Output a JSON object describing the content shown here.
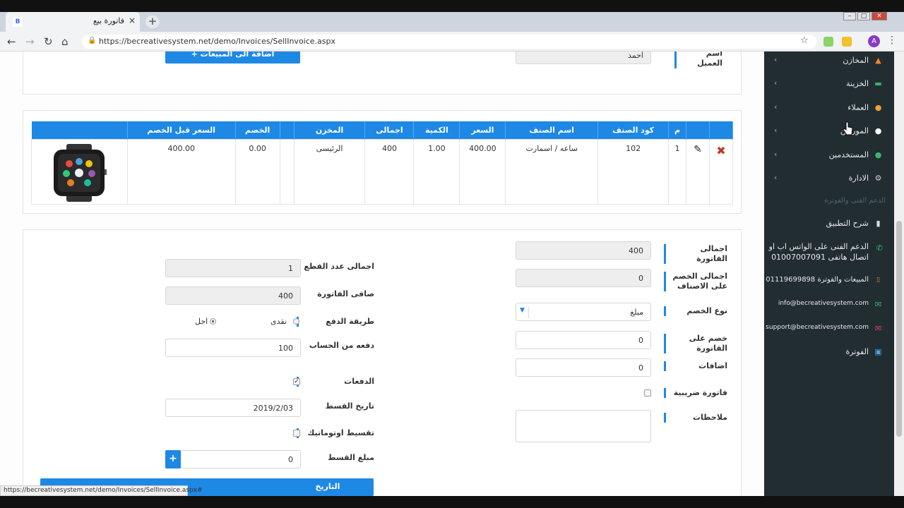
{
  "browser": {
    "tab_title": "فاتورة بيع",
    "favicon_letter": "B",
    "tab_close": "×",
    "new_tab": "+",
    "url": "https://becreativesystem.net/demo/Invoices/SellInvoice.aspx",
    "avatar_letter": "A",
    "status_url": "https://becreativesystem.net/demo/Invoices/SellInvoice.aspx#"
  },
  "customer": {
    "label": "اسم العميل",
    "value": "احمد",
    "add_button": "+ اضافة الى المبيعات"
  },
  "items_table": {
    "headers": [
      "",
      "",
      "م",
      "كود الصنف",
      "اسم الصنف",
      "السعر",
      "الكمية",
      "اجمالى",
      "المخزن",
      "",
      "الخصم",
      "السعر قبل الخصم",
      ""
    ],
    "row": {
      "num": "1",
      "code": "102",
      "name": "ساعه / اسمارت",
      "price": "400.00",
      "qty": "1.00",
      "total": "400",
      "store": "الرئيسى",
      "discount": "0.00",
      "price_before": "400.00"
    }
  },
  "summary_right": {
    "invoice_total_label": "اجمالى الفاتورة",
    "invoice_total": "400",
    "items_discount_label": "اجمالى الخصم على الاصناف",
    "items_discount": "0",
    "discount_type_label": "نوع الخصم",
    "discount_type": "مبلغ",
    "invoice_discount_label": "خصم على الفاتورة",
    "invoice_discount": "0",
    "additions_label": "اضافات",
    "additions": "0",
    "tax_invoice_label": "فاتورة ضريبية",
    "notes_label": "ملاحظات"
  },
  "summary_left": {
    "pieces_total_label": "اجمالى عدد القطع",
    "pieces_total": "1",
    "net_label": "صافى الفاتورة",
    "net": "400",
    "payment_method_label": "طريقة الدفع",
    "cash_label": "نقدى",
    "credit_label": "اجل",
    "paid_label": "دفعه من الحساب",
    "paid": "100",
    "installments_label": "الدفعات",
    "installment_date_label": "تاريخ القسط",
    "installment_date": "2019/2/03",
    "auto_split_label": "تقسيط اوتوماتيك",
    "installment_amount_label": "مبلغ القسط",
    "installment_amount": "0",
    "plus": "+",
    "date_header": "التاريخ"
  },
  "sidebar": {
    "items": [
      {
        "label": "المخازن",
        "icon": "warehouse-icon",
        "color": "#f0852d"
      },
      {
        "label": "الخزينة",
        "icon": "money-icon",
        "color": "#3cb371"
      },
      {
        "label": "العملاء",
        "icon": "users-icon",
        "color": "#f0a030"
      },
      {
        "label": "الموردين",
        "icon": "truck-icon",
        "color": "#ffffff"
      },
      {
        "label": "المستخدمين",
        "icon": "user-group-icon",
        "color": "#3cb371"
      },
      {
        "label": "الادارة",
        "icon": "cogs-icon",
        "color": "#cccccc"
      }
    ],
    "support_header": "الدعم الفنى والفوترة",
    "app_explain": "شرح التطبيق",
    "whatsapp_line1": "الدعم الفنى على الواتس اب او",
    "whatsapp_line2": "اتصال هاتفى 01007007091",
    "sales_billing": "المبيعات والفوترة 01119699898",
    "email_info": "info@becreativesystem.com",
    "email_support": "support@becreativesystem.com",
    "billing": "الفوترة"
  }
}
